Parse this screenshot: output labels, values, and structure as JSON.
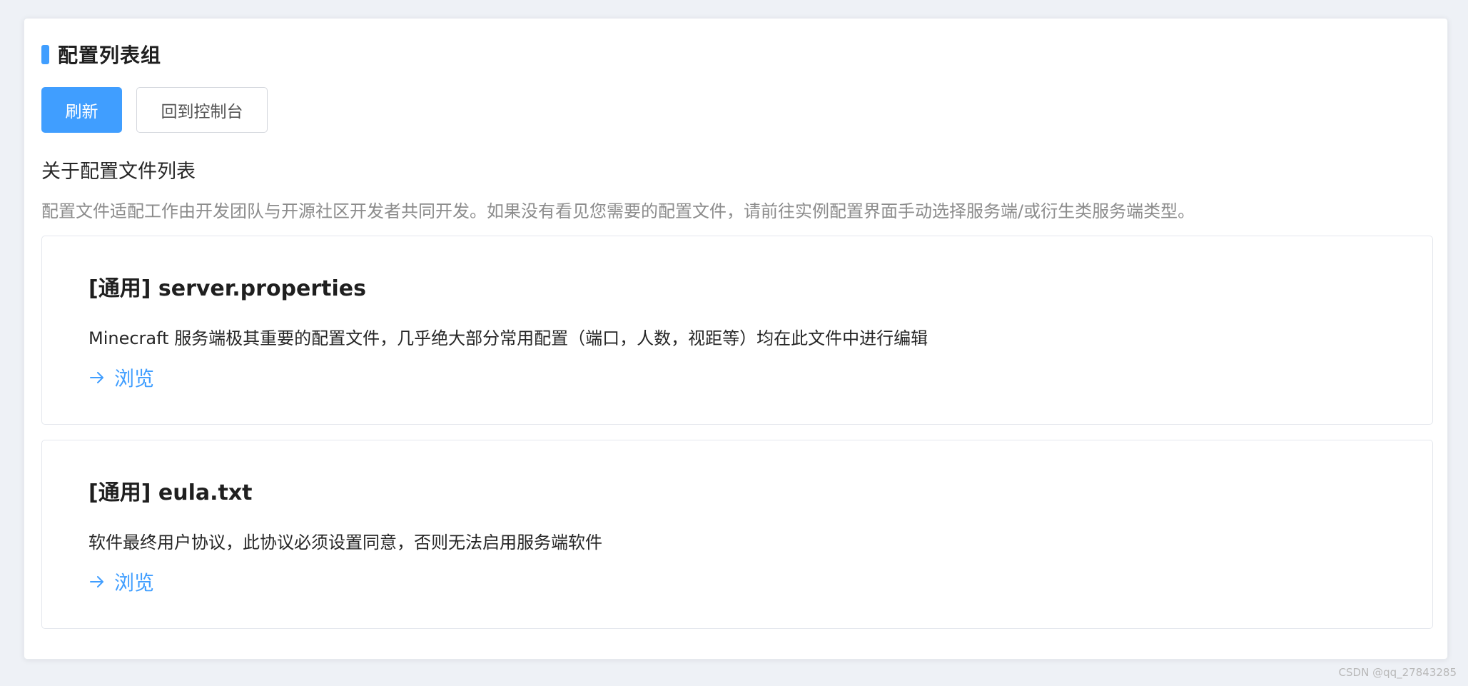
{
  "panel": {
    "title": "配置列表组"
  },
  "toolbar": {
    "refresh_label": "刷新",
    "back_label": "回到控制台"
  },
  "section": {
    "title": "关于配置文件列表",
    "description": "配置文件适配工作由开发团队与开源社区开发者共同开发。如果没有看见您需要的配置文件，请前往实例配置界面手动选择服务端/或衍生类服务端类型。"
  },
  "configs": [
    {
      "title": "[通用] server.properties",
      "description": "Minecraft 服务端极其重要的配置文件，几乎绝大部分常用配置（端口，人数，视距等）均在此文件中进行编辑",
      "link_label": "浏览",
      "link_icon": "arrow-right-icon"
    },
    {
      "title": "[通用] eula.txt",
      "description": "软件最终用户协议，此协议必须设置同意，否则无法启用服务端软件",
      "link_label": "浏览",
      "link_icon": "arrow-right-icon"
    }
  ],
  "watermark": "CSDN @qq_27843285",
  "colors": {
    "accent": "#409eff",
    "background": "#eef1f6",
    "muted_text": "#8c8c8c"
  }
}
